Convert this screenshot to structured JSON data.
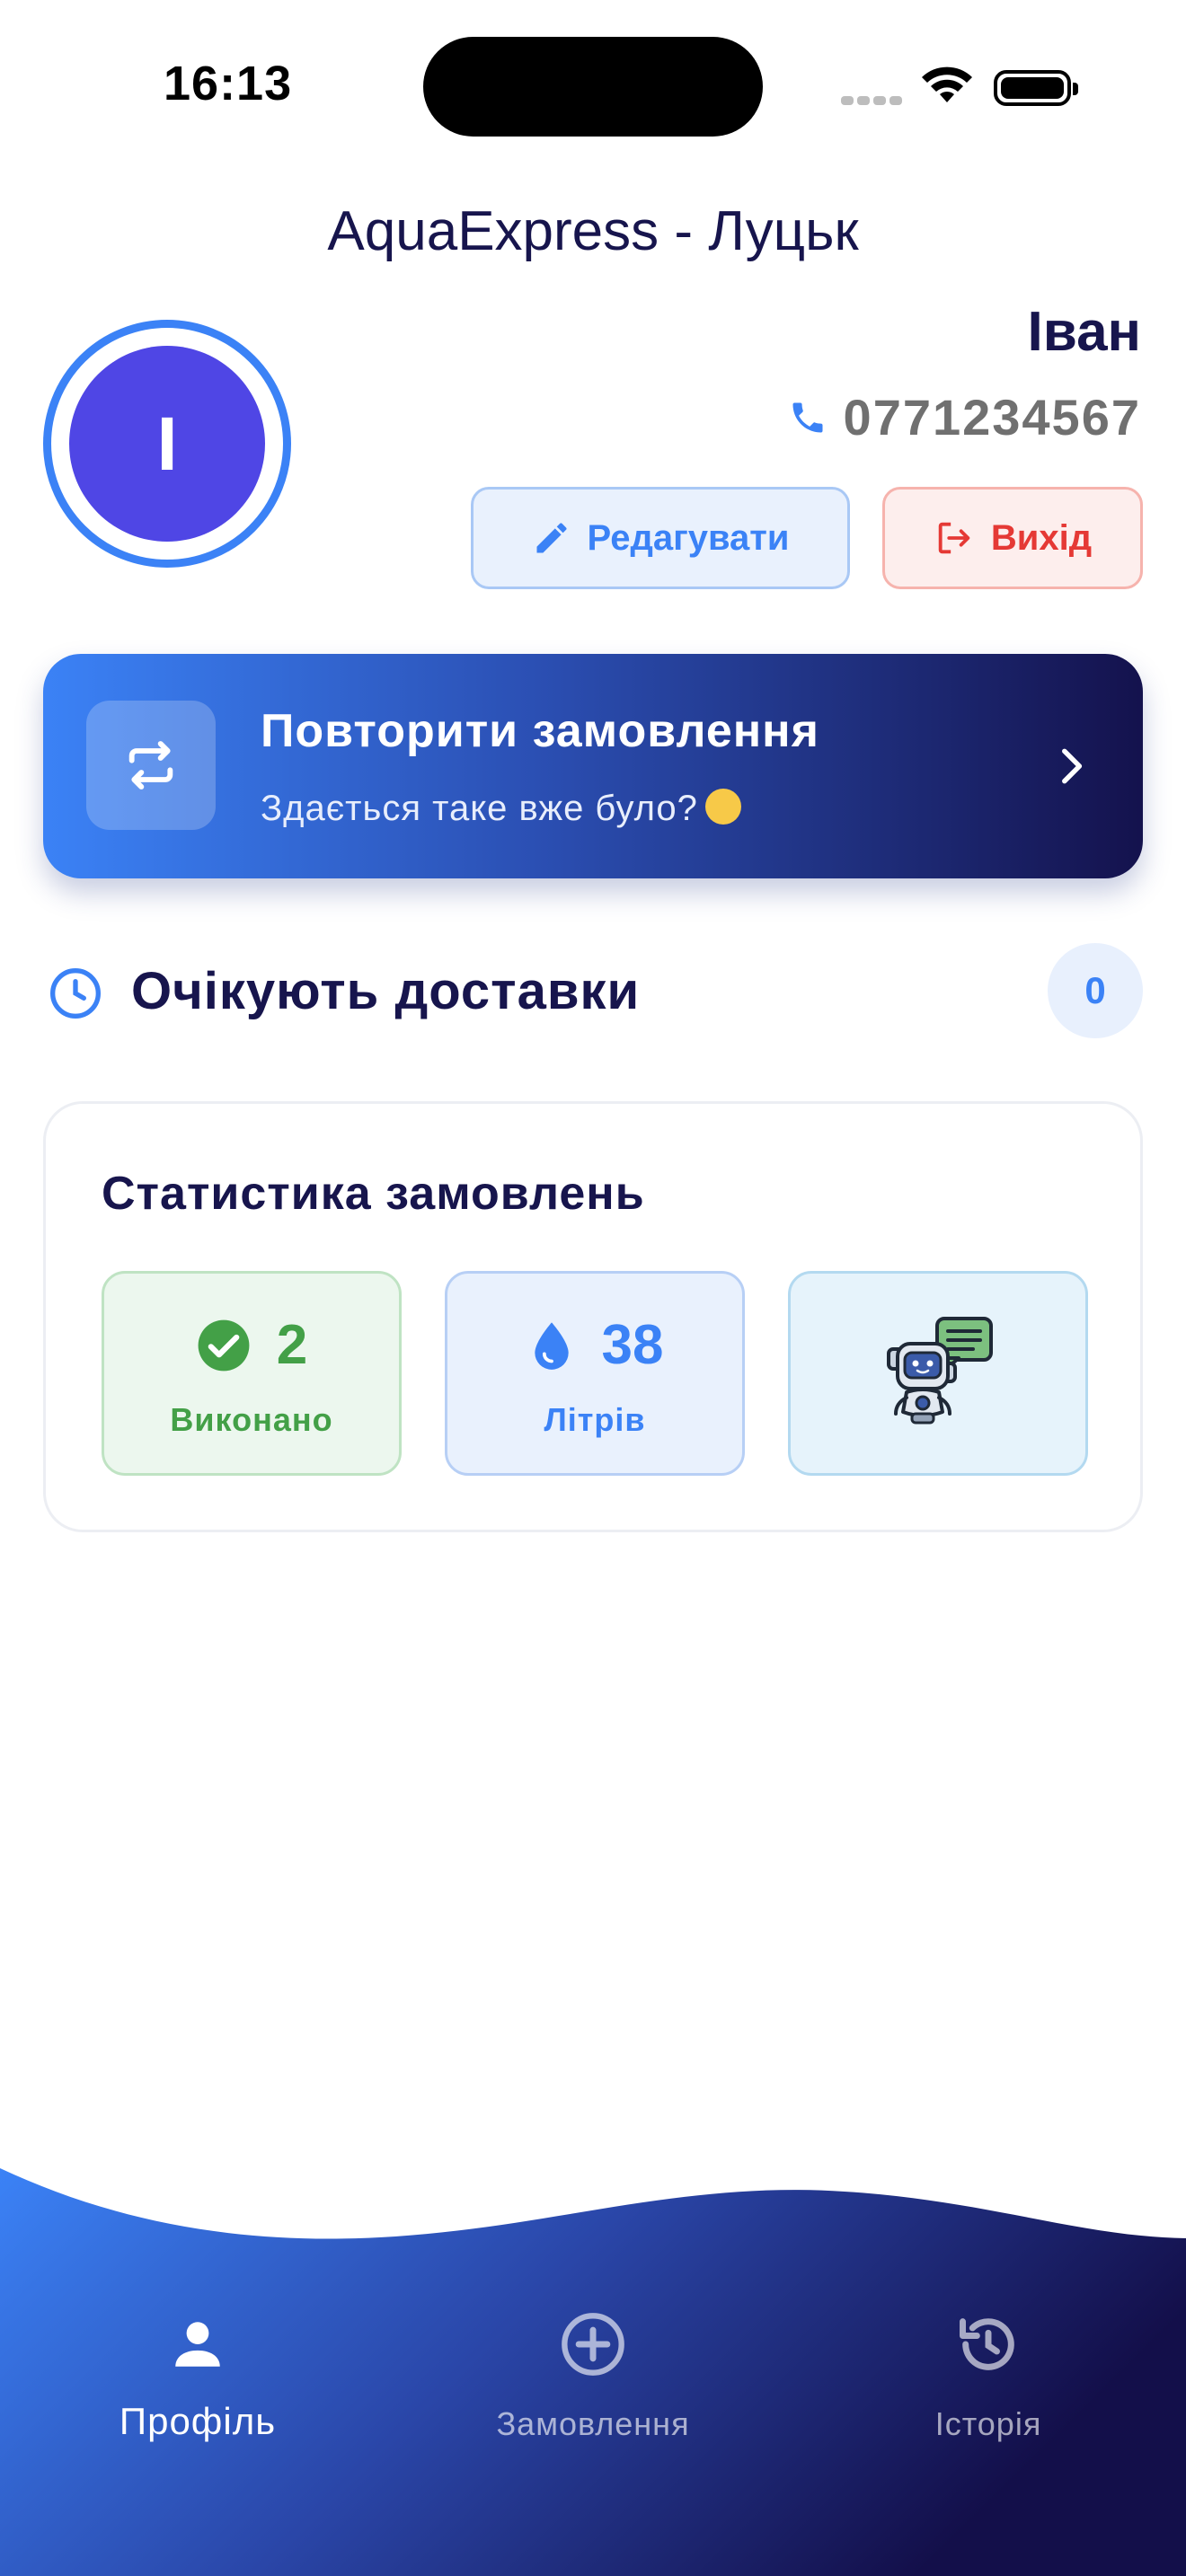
{
  "status_bar": {
    "time": "16:13"
  },
  "header": {
    "title": "AquaExpress - Луцьк"
  },
  "profile": {
    "avatar_initial": "І",
    "name": "Іван",
    "phone": "0771234567",
    "edit_label": "Редагувати",
    "logout_label": "Вихід"
  },
  "repeat_order": {
    "title": "Повторити замовлення",
    "subtitle": "Здається таке вже було?"
  },
  "pending": {
    "title": "Очікують доставки",
    "count": "0"
  },
  "stats": {
    "title": "Статистика замовлень",
    "done_value": "2",
    "done_label": "Виконано",
    "liters_value": "38",
    "liters_label": "Літрів"
  },
  "nav": {
    "items": [
      {
        "label": "Профіль",
        "icon": "person-icon",
        "active": true
      },
      {
        "label": "Замовлення",
        "icon": "add-circle-icon",
        "active": false
      },
      {
        "label": "Історія",
        "icon": "history-icon",
        "active": false
      }
    ]
  },
  "colors": {
    "primary": "#3b82f6",
    "dark": "#14124d",
    "avatar": "#4f46e5",
    "danger": "#e53935",
    "success": "#43a047"
  }
}
